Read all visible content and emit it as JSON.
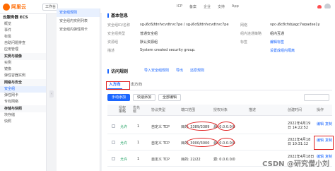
{
  "topbar": {
    "logo_text": "阿里云",
    "home_label": "工作台",
    "links": [
      "ICP",
      "备案",
      "企业",
      "支持",
      "App"
    ]
  },
  "sidebar": {
    "title": "云服务器 ECS",
    "items_top": [
      "概览",
      "事件",
      "标签",
      "自助问题排查",
      "应用管理"
    ],
    "group1": "实例与镜像",
    "items_g1": [
      "实例",
      "镜像"
    ],
    "group_img": "弹性容器实例",
    "group2": "网络与安全",
    "items_g2": [
      "安全组",
      "弹性网卡",
      "专有网络"
    ],
    "group3": "存储与快照",
    "items_g3": [
      "块存储",
      "快照"
    ]
  },
  "subnav": {
    "items": [
      "安全组规则",
      "安全组内实例列表",
      "安全组内弹性网卡"
    ]
  },
  "basic_info": {
    "title": "基本信息",
    "rows": [
      {
        "label": "安全组ID/名称",
        "value": "sg-j6c6jfdnfvcvdtrvc7pe / sg-j6c6jfdnfvcvdtrvc7pe"
      },
      {
        "label": "安全组类型",
        "value": "普通安全组"
      },
      {
        "label": "资源组",
        "value": "默认资源组"
      },
      {
        "label": "描述",
        "value": "System created security group."
      }
    ],
    "right_rows": [
      {
        "label": "网络",
        "value": "vpc-j6c8cfsbjagc7wpadxe1y"
      },
      {
        "label": "组内连通策略",
        "value": "组内互通"
      },
      {
        "label": "标签",
        "value": "编辑标签"
      },
      {
        "label": "",
        "value": "设置成组内隔离"
      }
    ]
  },
  "rules": {
    "section_title": "访问规则",
    "actions": [
      "导入安全组规则",
      "导出",
      "还原规则"
    ],
    "tabs": [
      "入方向",
      "出方向"
    ],
    "buttons": [
      "手动添加",
      "快速添加",
      "全部编辑"
    ],
    "headers": [
      "授权策略",
      "优先级",
      "协议类型",
      "端口范围",
      "授权对象",
      "描述",
      "创建时间",
      "操作"
    ],
    "rows": [
      {
        "policy": "允许",
        "priority": "1",
        "protocol": "自定义 TCP",
        "port": "目的: 3389/3389",
        "object": "源: 0.0.0.0/0",
        "desc": "",
        "time": "2022年4月19日 14:22:52",
        "ops": [
          "编辑",
          "复制"
        ]
      },
      {
        "policy": "允许",
        "priority": "1",
        "protocol": "自定义 TCP",
        "port": "目的: 3000/3000",
        "object": "源: 0.0.0.0/0",
        "desc": "",
        "time": "2022年4月18日 10:31:12",
        "ops": [
          "编辑",
          "复制"
        ]
      },
      {
        "policy": "允许",
        "priority": "1",
        "protocol": "自定义 TCP",
        "port": "目的: 22/22",
        "object": "源: 0.0.0.0/0",
        "desc": "",
        "time": "2022年4月18日",
        "ops": [
          "编辑",
          "复制"
        ]
      }
    ]
  },
  "watermark": "CSDN @研究僧小刘"
}
